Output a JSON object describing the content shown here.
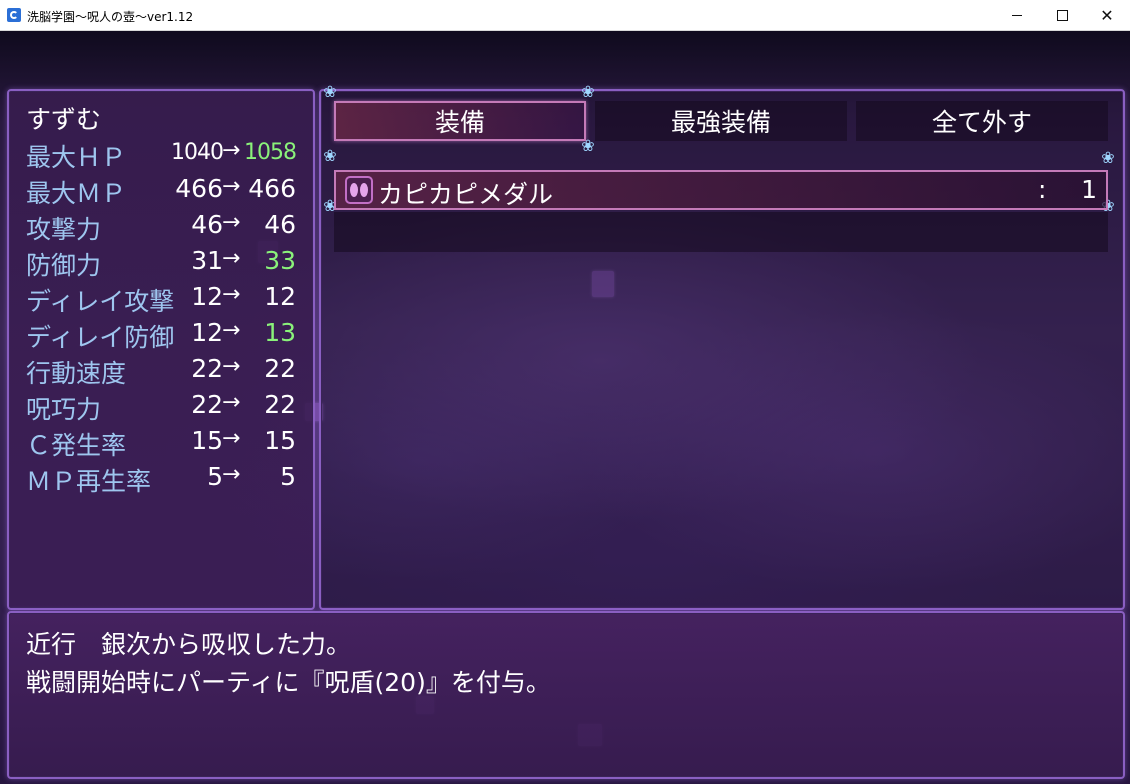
{
  "window": {
    "title": "洗脳学園～呪人の壺～ver1.12",
    "minimize_label": "",
    "maximize_label": "",
    "close_label": "✕"
  },
  "status": {
    "character_name": "すずむ",
    "arrow": "→",
    "stats": [
      {
        "label": "最大ＨＰ",
        "current": "1040",
        "new": "1058",
        "increased": true
      },
      {
        "label": "最大ＭＰ",
        "current": "466",
        "new": "466",
        "increased": false
      },
      {
        "label": "攻撃力",
        "current": "46",
        "new": "46",
        "increased": false
      },
      {
        "label": "防御力",
        "current": "31",
        "new": "33",
        "increased": true
      },
      {
        "label": "ディレイ攻撃",
        "current": "12",
        "new": "12",
        "increased": false
      },
      {
        "label": "ディレイ防御",
        "current": "12",
        "new": "13",
        "increased": true
      },
      {
        "label": "行動速度",
        "current": "22",
        "new": "22",
        "increased": false
      },
      {
        "label": "呪巧力",
        "current": "22",
        "new": "22",
        "increased": false
      },
      {
        "label": "Ｃ発生率",
        "current": "15",
        "new": "15",
        "increased": false
      },
      {
        "label": "ＭＰ再生率",
        "current": "5",
        "new": "5",
        "increased": false
      }
    ]
  },
  "commands": {
    "equip": "装備",
    "optimize": "最強装備",
    "clear": "全て外す",
    "selected": "equip"
  },
  "item_list": {
    "items": [
      {
        "name": "カピカピメダル",
        "separator": ":",
        "count": "1",
        "icon": "medal-icon"
      }
    ]
  },
  "help": {
    "line1": "近行　銀次から吸収した力。",
    "line2": "戦闘開始時にパーティに『呪盾(20)』を付与。"
  },
  "colors": {
    "stat_label": "#9ec6ef",
    "increase": "#8af27a",
    "window_border": "#8a5fc2",
    "selection_border": "#c47ab8"
  }
}
